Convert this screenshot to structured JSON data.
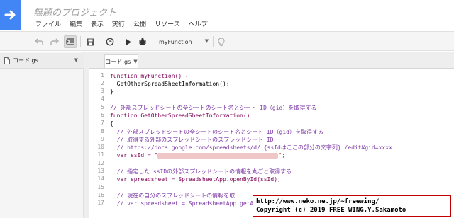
{
  "header": {
    "title": "無題のプロジェクト",
    "logo_icon": "apps-script-arrow-icon",
    "menu": [
      "ファイル",
      "編集",
      "表示",
      "実行",
      "公開",
      "リソース",
      "ヘルプ"
    ]
  },
  "toolbar": {
    "buttons": [
      "undo-icon",
      "redo-icon",
      "indent-icon",
      "save-icon",
      "triggers-clock-icon",
      "run-play-icon",
      "debug-bug-icon",
      "lightbulb-icon"
    ],
    "function_select": "myFunction"
  },
  "sidebar": {
    "file_name": "コード.gs"
  },
  "editor": {
    "tab_label": "コード.gs",
    "line_numbers": [
      "1",
      "2",
      "3",
      "4",
      "5",
      "6",
      "7",
      "8",
      "9",
      "10",
      "11",
      "12",
      "13",
      "14",
      "15",
      "16",
      "17"
    ],
    "lines": [
      "function myFunction() {",
      "  GetOtherSpreadSheetInformation();",
      "}",
      "",
      "// 外部スプレッドシートの全シートのシート名とシート ID（gid）を取得する",
      "function GetOtherSpreadSheetInformation()",
      "{",
      "  // 外部スプレッドシートの全シートのシート名とシート ID（gid）を取得する",
      "  // 取得する外部のスプレッドシートのスプレッドシート ID",
      "  // https://docs.google.com/spreadsheets/d/ {ssIdはここの部分の文字列} /edit#gid=xxxx",
      "  var ssId = \"",
      "",
      "  // 指定した ssIDの外部スプレッドシートの情報を丸ごと取得する",
      "  var spreadsheet = SpreadsheetApp.openById(ssId);",
      "",
      "  // 現在の自分のスプレッドシートの情報を取",
      "  // var spreadsheet = SpreadsheetApp.getActiveSpreadsheet();"
    ]
  },
  "watermark": {
    "url": "http://www.neko.ne.jp/~freewing/",
    "copyright": "Copyright (c) 2019 FREE WING,Y.Sakamoto"
  },
  "colors": {
    "brand_blue": "#4285f4",
    "keyword": "#7f0055",
    "comment": "#7b37a5",
    "string": "#c0392b"
  }
}
